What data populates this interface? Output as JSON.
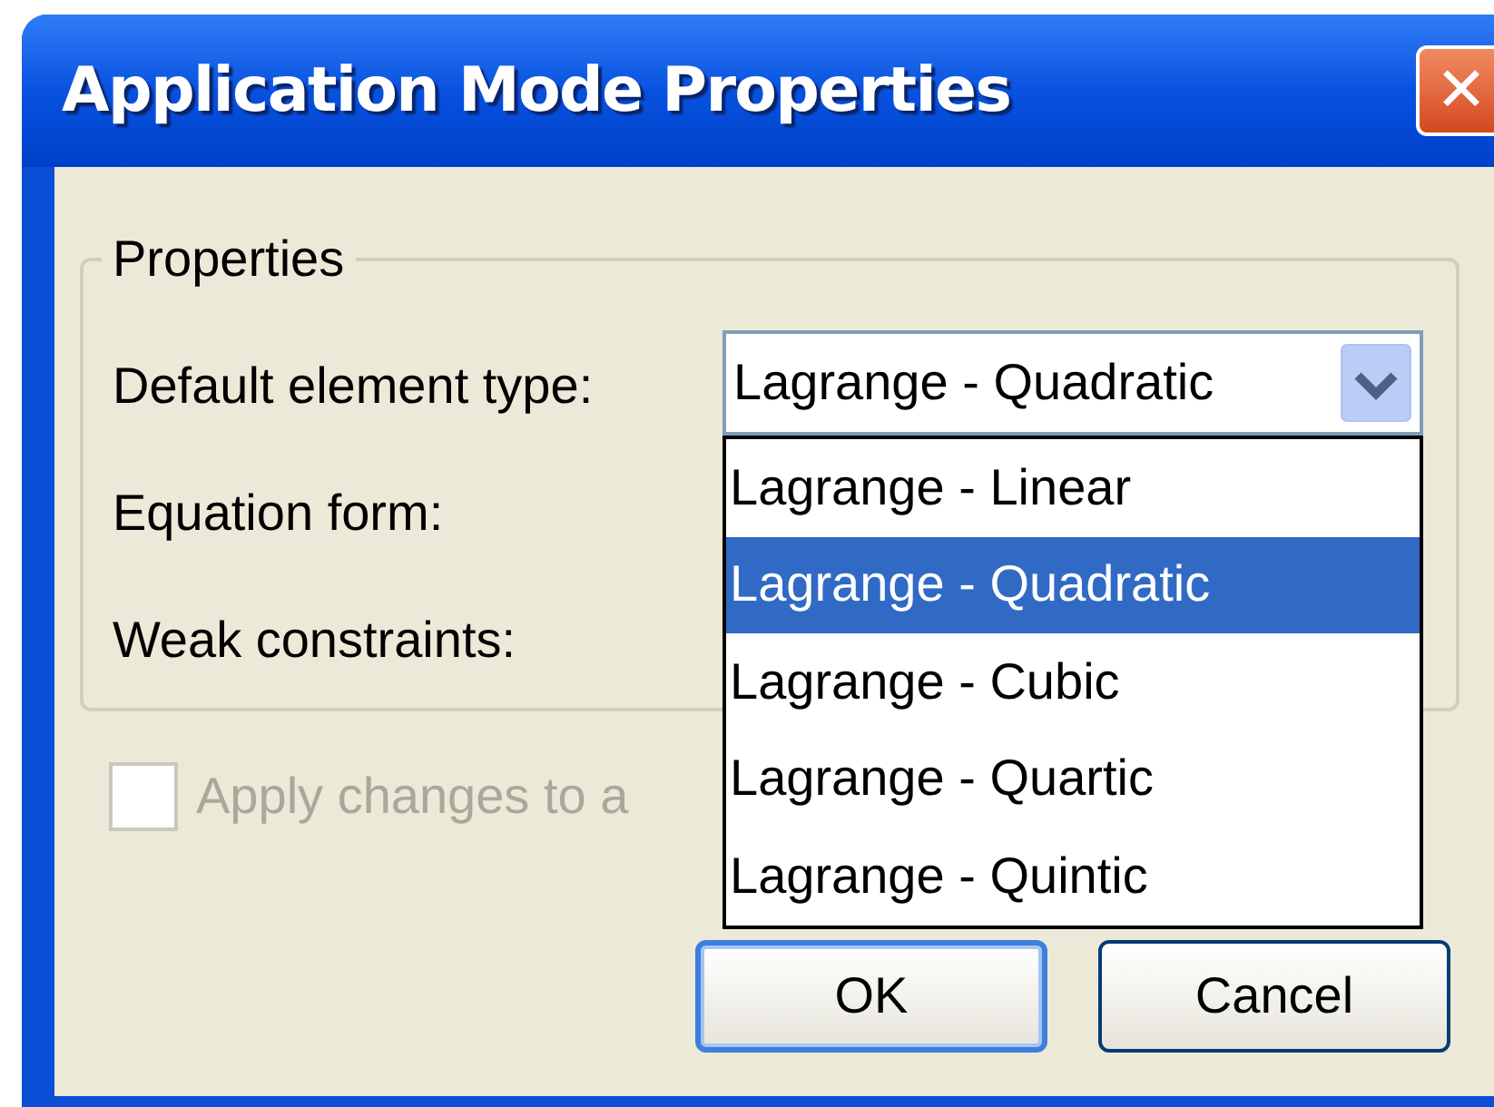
{
  "window": {
    "title": "Application Mode Properties",
    "close": "✕"
  },
  "group": {
    "title": "Properties",
    "fields": [
      {
        "label": "Default element type:",
        "value": "Lagrange - Quadratic",
        "expanded": true
      },
      {
        "label": "Equation form:"
      },
      {
        "label": "Weak constraints:"
      }
    ]
  },
  "checkbox": {
    "label": "Apply changes to a",
    "checked": false,
    "disabled": true
  },
  "dropdown": {
    "options": [
      {
        "label": "Lagrange - Linear",
        "selected": false
      },
      {
        "label": "Lagrange - Quadratic",
        "selected": true
      },
      {
        "label": "Lagrange - Cubic",
        "selected": false
      },
      {
        "label": "Lagrange - Quartic",
        "selected": false
      },
      {
        "label": "Lagrange - Quintic",
        "selected": false
      }
    ]
  },
  "buttons": [
    {
      "label": "OK",
      "default": true
    },
    {
      "label": "Cancel",
      "default": false
    }
  ]
}
